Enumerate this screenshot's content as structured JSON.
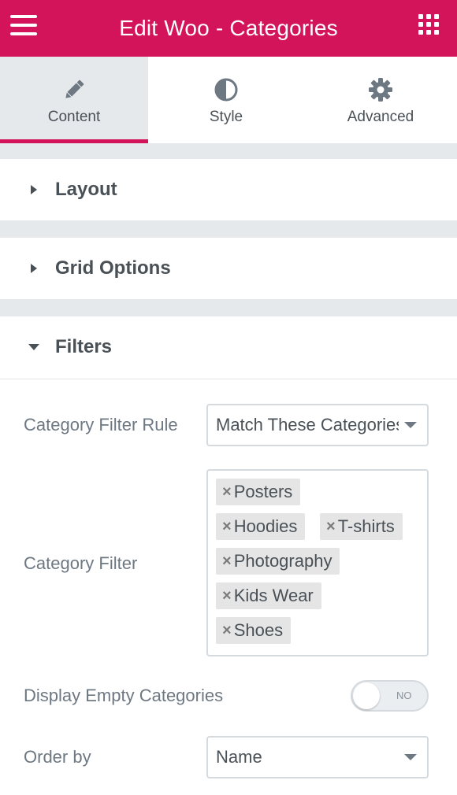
{
  "header": {
    "title": "Edit Woo - Categories",
    "menu_icon": "hamburger-icon",
    "apps_icon": "grid-icon",
    "bg_color": "#d4145a"
  },
  "tabs": [
    {
      "label": "Content",
      "icon": "pencil-icon",
      "active": true
    },
    {
      "label": "Style",
      "icon": "half-circle-icon",
      "active": false
    },
    {
      "label": "Advanced",
      "icon": "gear-icon",
      "active": false
    }
  ],
  "sections": {
    "layout": {
      "title": "Layout",
      "expanded": false
    },
    "grid_options": {
      "title": "Grid Options",
      "expanded": false
    },
    "filters": {
      "title": "Filters",
      "expanded": true
    }
  },
  "filters": {
    "category_filter_rule": {
      "label": "Category Filter Rule",
      "value": "Match These Categories"
    },
    "category_filter": {
      "label": "Category Filter",
      "tags": [
        "Posters",
        "Hoodies",
        "T-shirts",
        "Photography",
        "Kids Wear",
        "Shoes"
      ],
      "remove_icon": "close-icon"
    },
    "display_empty": {
      "label": "Display Empty Categories",
      "state": "NO"
    },
    "order_by": {
      "label": "Order by",
      "value": "Name"
    }
  }
}
